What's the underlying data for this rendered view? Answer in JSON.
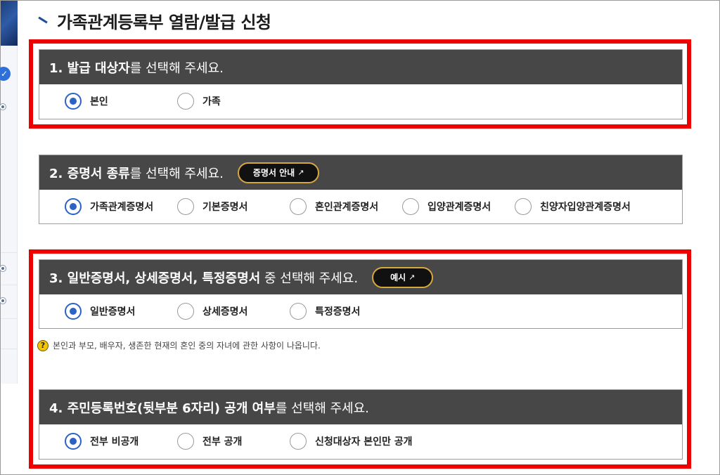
{
  "page": {
    "title": "가족관계등록부 열람/발급 신청"
  },
  "sidebar": {
    "check_glyph": "✓"
  },
  "sections": [
    {
      "title_bold": "1. 발급 대상자",
      "title_rest": "를 선택해 주세요.",
      "options": [
        {
          "label": "본인",
          "selected": true
        },
        {
          "label": "가족",
          "selected": false
        }
      ]
    },
    {
      "title_bold": "2. 증명서 종류",
      "title_rest": "를 선택해 주세요.",
      "button": {
        "label": "증명서 안내",
        "icon": "↗"
      },
      "options": [
        {
          "label": "가족관계증명서",
          "selected": true
        },
        {
          "label": "기본증명서",
          "selected": false
        },
        {
          "label": "혼인관계증명서",
          "selected": false
        },
        {
          "label": "입양관계증명서",
          "selected": false
        },
        {
          "label": "친양자입양관계증명서",
          "selected": false
        }
      ]
    },
    {
      "title_bold": "3. 일반증명서, 상세증명서, 특정증명서",
      "title_rest": " 중 선택해 주세요.",
      "button": {
        "label": "예시",
        "icon": "↗"
      },
      "options": [
        {
          "label": "일반증명서",
          "selected": true
        },
        {
          "label": "상세증명서",
          "selected": false
        },
        {
          "label": "특정증명서",
          "selected": false
        }
      ]
    },
    {
      "title_bold": "4. 주민등록번호(뒷부분 6자리) 공개 여부",
      "title_rest": "를 선택해 주세요.",
      "options": [
        {
          "label": "전부 비공개",
          "selected": true
        },
        {
          "label": "전부 공개",
          "selected": false
        },
        {
          "label": "신청대상자 본인만 공개",
          "selected": false
        }
      ]
    }
  ],
  "help_note": {
    "icon": "?",
    "text": "본인과 부모, 배우자, 생존한 현재의 혼인 중의 자녀에 관한 사항이 나옵니다."
  },
  "colors": {
    "accent": "#2c62c6",
    "highlight_frame": "#ee0000",
    "header_bg": "#474747",
    "pill_border": "#d6a93e"
  }
}
